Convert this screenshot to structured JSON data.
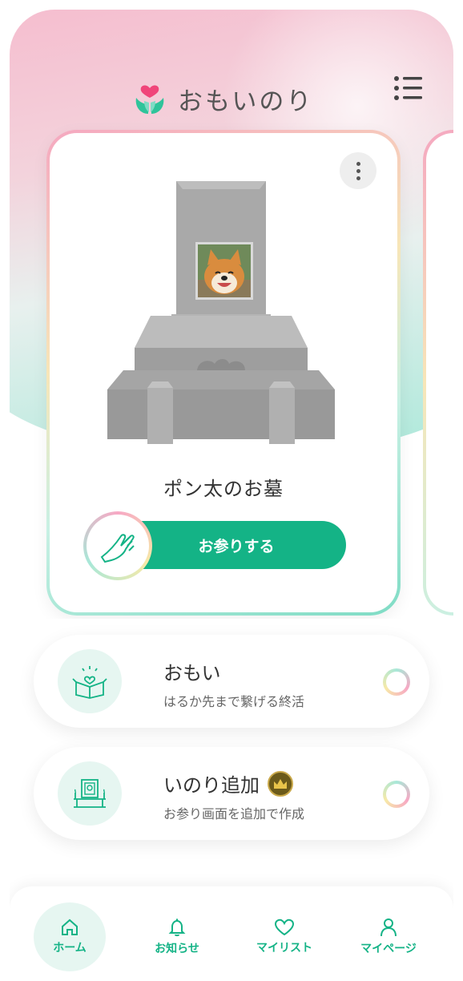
{
  "app": {
    "logo_text": "おもいのり"
  },
  "colors": {
    "accent": "#14b386",
    "accent_light": "#e6f6f1",
    "pink": "#f5a8c0",
    "mint": "#7fdcc5"
  },
  "main_card": {
    "grave_name": "ポン太のお墓",
    "pray_button_label": "お参りする",
    "photo_icon": "shiba-dog-photo"
  },
  "features": [
    {
      "title": "おもい",
      "subtitle": "はるか先まで繋げる終活",
      "icon": "gift-box-heart-icon"
    },
    {
      "title": "いのり追加",
      "subtitle": "お参り画面を追加で作成",
      "icon": "altar-icon",
      "badge_icon": "crown-icon"
    }
  ],
  "tabbar": {
    "items": [
      {
        "label": "ホーム",
        "icon": "home-icon",
        "active": true
      },
      {
        "label": "お知らせ",
        "icon": "bell-icon",
        "active": false
      },
      {
        "label": "マイリスト",
        "icon": "heart-icon",
        "active": false
      },
      {
        "label": "マイページ",
        "icon": "person-icon",
        "active": false
      }
    ]
  }
}
